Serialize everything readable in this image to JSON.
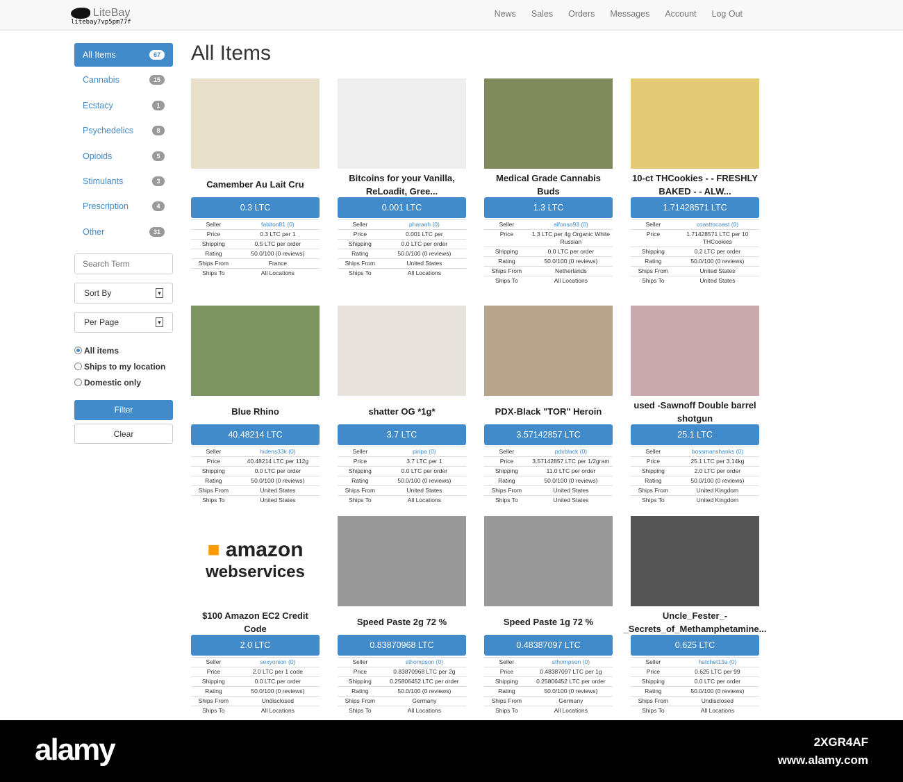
{
  "header": {
    "brand": "LiteBay",
    "onion": "litebay7vp5pm77f",
    "nav": [
      "News",
      "Sales",
      "Orders",
      "Messages",
      "Account",
      "Log Out"
    ]
  },
  "sidebar": {
    "categories": [
      {
        "label": "All Items",
        "count": "67",
        "active": true
      },
      {
        "label": "Cannabis",
        "count": "15"
      },
      {
        "label": "Ecstacy",
        "count": "1"
      },
      {
        "label": "Psychedelics",
        "count": "8"
      },
      {
        "label": "Opioids",
        "count": "5"
      },
      {
        "label": "Stimulants",
        "count": "3"
      },
      {
        "label": "Prescription",
        "count": "4"
      },
      {
        "label": "Other",
        "count": "31"
      }
    ],
    "search_placeholder": "Search Term",
    "sort_by": "Sort By",
    "per_page": "Per Page",
    "radios": [
      {
        "label": "All items",
        "checked": true
      },
      {
        "label": "Ships to my location"
      },
      {
        "label": "Domestic only"
      }
    ],
    "filter": "Filter",
    "clear": "Clear"
  },
  "page_title": "All Items",
  "labels": [
    "Seller",
    "Price",
    "Shipping",
    "Rating",
    "Ships From",
    "Ships To"
  ],
  "items": [
    [
      {
        "title": "Camember Au Lait Cru",
        "price": "0.3 LTC",
        "seller": "fabiton81 (0)",
        "unit": "0.3 LTC per 1",
        "shipping": "0.5 LTC per order",
        "rating": "50.0/100 (0 reviews)",
        "from": "France",
        "to": "All Locations",
        "img": "#e9e0cc"
      },
      {
        "title": "Bitcoins for your Vanilla, ReLoadit, Gree...",
        "price": "0.001 LTC",
        "seller": "pharaoh (0)",
        "unit": "0.001 LTC per",
        "shipping": "0.0 LTC per order",
        "rating": "50.0/100 (0 reviews)",
        "from": "United States",
        "to": "All Locations",
        "img": "#eeeeee"
      },
      {
        "title": "Medical Grade Cannabis Buds",
        "price": "1.3 LTC",
        "seller": "alfonso93 (0)",
        "unit": "1.3 LTC per 4g Organic White Russian",
        "shipping": "0.0 LTC per order",
        "rating": "50.0/100 (0 reviews)",
        "from": "Netherlands",
        "to": "All Locations",
        "img": "#7f8a5a"
      },
      {
        "title": "10-ct THCookies - - FRESHLY BAKED - - ALW...",
        "price": "1.71428571 LTC",
        "seller": "coasttocoast (0)",
        "unit": "1.71428571 LTC per 10 THCookies",
        "shipping": "0.2 LTC per order",
        "rating": "50.0/100 (0 reviews)",
        "from": "United States",
        "to": "United States",
        "img": "#e3c978"
      }
    ],
    [
      {
        "title": "Blue Rhino",
        "price": "40.48214 LTC",
        "seller": "hidens33k (0)",
        "unit": "40.48214 LTC per 112g",
        "shipping": "0.0 LTC per order",
        "rating": "50.0/100 (0 reviews)",
        "from": "United States",
        "to": "United States",
        "img": "#7d9460"
      },
      {
        "title": "shatter OG *1g*",
        "price": "3.7 LTC",
        "seller": "piripa (0)",
        "unit": "3.7 LTC per 1",
        "shipping": "0.0 LTC per order",
        "rating": "50.0/100 (0 reviews)",
        "from": "United States",
        "to": "All Locations",
        "img": "#e8e4dc"
      },
      {
        "title": "PDX-Black \"TOR\" Heroin",
        "price": "3.57142857 LTC",
        "seller": "pdxblack (0)",
        "unit": "3.57142857 LTC per 1/2gram",
        "shipping": "11.0 LTC per order",
        "rating": "50.0/100 (0 reviews)",
        "from": "United States",
        "to": "United States",
        "img": "#b9a48c"
      },
      {
        "title": "used -Sawnoff Double barrel shotgun",
        "price": "25.1 LTC",
        "seller": "bossmanshanks (0)",
        "unit": "25.1 LTC per 3.14kg",
        "shipping": "2.0 LTC per order",
        "rating": "50.0/100 (0 reviews)",
        "from": "United Kingdom",
        "to": "United Kingdom",
        "img": "#c9a9ad"
      }
    ],
    [
      {
        "title": "$100 Amazon EC2 Credit Code",
        "price": "2.0 LTC",
        "seller": "sexyonion (0)",
        "unit": "2.0 LTC per 1 code",
        "shipping": "0.0 LTC per order",
        "rating": "50.0/100 (0 reviews)",
        "from": "Undisclosed",
        "to": "All Locations",
        "img": "#ffffff",
        "logo": "amazon webservices"
      },
      {
        "title": "Speed Paste 2g 72 %",
        "price": "0.83870968 LTC",
        "seller": "sthompson (0)",
        "unit": "0.83870968 LTC per 2g",
        "shipping": "0.25806452 LTC per order",
        "rating": "50.0/100 (0 reviews)",
        "from": "Germany",
        "to": "All Locations",
        "img": "#999999"
      },
      {
        "title": "Speed Paste 1g 72 %",
        "price": "0.48387097 LTC",
        "seller": "sthompson (0)",
        "unit": "0.48387097 LTC per 1g",
        "shipping": "0.25806452 LTC per order",
        "rating": "50.0/100 (0 reviews)",
        "from": "Germany",
        "to": "All Locations",
        "img": "#999999"
      },
      {
        "title": "Uncle_Fester_-_Secrets_of_Methamphetamine...",
        "price": "0.625 LTC",
        "seller": "hatchet13a (0)",
        "unit": "0.625 LTC per 99",
        "shipping": "0.0 LTC per order",
        "rating": "50.0/100 (0 reviews)",
        "from": "Undisclosed",
        "to": "All Locations",
        "img": "#555555"
      }
    ]
  ],
  "watermark": {
    "logo": "alamy",
    "id": "2XGR4AF",
    "url": "www.alamy.com"
  },
  "colors": {
    "accent": "#428bca"
  }
}
